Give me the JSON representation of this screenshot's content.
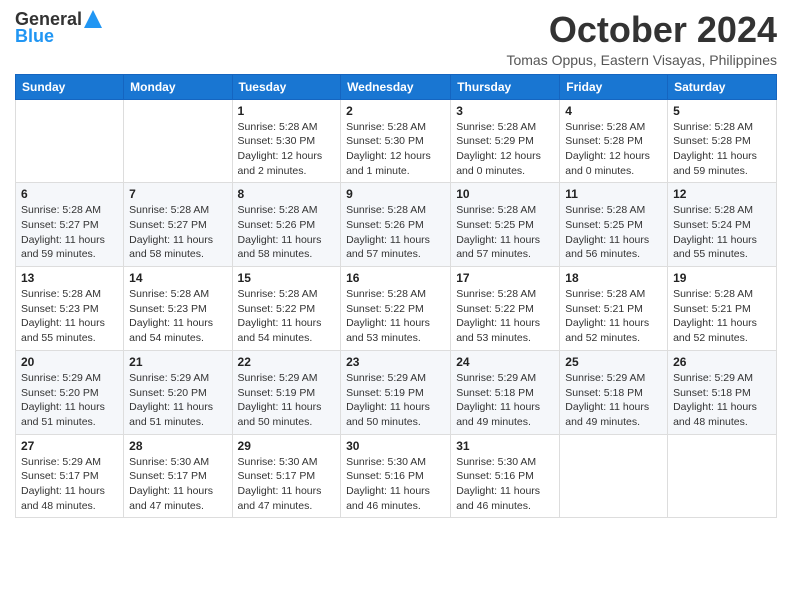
{
  "logo": {
    "general": "General",
    "blue": "Blue"
  },
  "header": {
    "month": "October 2024",
    "subtitle": "Tomas Oppus, Eastern Visayas, Philippines"
  },
  "days_of_week": [
    "Sunday",
    "Monday",
    "Tuesday",
    "Wednesday",
    "Thursday",
    "Friday",
    "Saturday"
  ],
  "weeks": [
    [
      {
        "day": "",
        "info": ""
      },
      {
        "day": "",
        "info": ""
      },
      {
        "day": "1",
        "info": "Sunrise: 5:28 AM\nSunset: 5:30 PM\nDaylight: 12 hours and 2 minutes."
      },
      {
        "day": "2",
        "info": "Sunrise: 5:28 AM\nSunset: 5:30 PM\nDaylight: 12 hours and 1 minute."
      },
      {
        "day": "3",
        "info": "Sunrise: 5:28 AM\nSunset: 5:29 PM\nDaylight: 12 hours and 0 minutes."
      },
      {
        "day": "4",
        "info": "Sunrise: 5:28 AM\nSunset: 5:28 PM\nDaylight: 12 hours and 0 minutes."
      },
      {
        "day": "5",
        "info": "Sunrise: 5:28 AM\nSunset: 5:28 PM\nDaylight: 11 hours and 59 minutes."
      }
    ],
    [
      {
        "day": "6",
        "info": "Sunrise: 5:28 AM\nSunset: 5:27 PM\nDaylight: 11 hours and 59 minutes."
      },
      {
        "day": "7",
        "info": "Sunrise: 5:28 AM\nSunset: 5:27 PM\nDaylight: 11 hours and 58 minutes."
      },
      {
        "day": "8",
        "info": "Sunrise: 5:28 AM\nSunset: 5:26 PM\nDaylight: 11 hours and 58 minutes."
      },
      {
        "day": "9",
        "info": "Sunrise: 5:28 AM\nSunset: 5:26 PM\nDaylight: 11 hours and 57 minutes."
      },
      {
        "day": "10",
        "info": "Sunrise: 5:28 AM\nSunset: 5:25 PM\nDaylight: 11 hours and 57 minutes."
      },
      {
        "day": "11",
        "info": "Sunrise: 5:28 AM\nSunset: 5:25 PM\nDaylight: 11 hours and 56 minutes."
      },
      {
        "day": "12",
        "info": "Sunrise: 5:28 AM\nSunset: 5:24 PM\nDaylight: 11 hours and 55 minutes."
      }
    ],
    [
      {
        "day": "13",
        "info": "Sunrise: 5:28 AM\nSunset: 5:23 PM\nDaylight: 11 hours and 55 minutes."
      },
      {
        "day": "14",
        "info": "Sunrise: 5:28 AM\nSunset: 5:23 PM\nDaylight: 11 hours and 54 minutes."
      },
      {
        "day": "15",
        "info": "Sunrise: 5:28 AM\nSunset: 5:22 PM\nDaylight: 11 hours and 54 minutes."
      },
      {
        "day": "16",
        "info": "Sunrise: 5:28 AM\nSunset: 5:22 PM\nDaylight: 11 hours and 53 minutes."
      },
      {
        "day": "17",
        "info": "Sunrise: 5:28 AM\nSunset: 5:22 PM\nDaylight: 11 hours and 53 minutes."
      },
      {
        "day": "18",
        "info": "Sunrise: 5:28 AM\nSunset: 5:21 PM\nDaylight: 11 hours and 52 minutes."
      },
      {
        "day": "19",
        "info": "Sunrise: 5:28 AM\nSunset: 5:21 PM\nDaylight: 11 hours and 52 minutes."
      }
    ],
    [
      {
        "day": "20",
        "info": "Sunrise: 5:29 AM\nSunset: 5:20 PM\nDaylight: 11 hours and 51 minutes."
      },
      {
        "day": "21",
        "info": "Sunrise: 5:29 AM\nSunset: 5:20 PM\nDaylight: 11 hours and 51 minutes."
      },
      {
        "day": "22",
        "info": "Sunrise: 5:29 AM\nSunset: 5:19 PM\nDaylight: 11 hours and 50 minutes."
      },
      {
        "day": "23",
        "info": "Sunrise: 5:29 AM\nSunset: 5:19 PM\nDaylight: 11 hours and 50 minutes."
      },
      {
        "day": "24",
        "info": "Sunrise: 5:29 AM\nSunset: 5:18 PM\nDaylight: 11 hours and 49 minutes."
      },
      {
        "day": "25",
        "info": "Sunrise: 5:29 AM\nSunset: 5:18 PM\nDaylight: 11 hours and 49 minutes."
      },
      {
        "day": "26",
        "info": "Sunrise: 5:29 AM\nSunset: 5:18 PM\nDaylight: 11 hours and 48 minutes."
      }
    ],
    [
      {
        "day": "27",
        "info": "Sunrise: 5:29 AM\nSunset: 5:17 PM\nDaylight: 11 hours and 48 minutes."
      },
      {
        "day": "28",
        "info": "Sunrise: 5:30 AM\nSunset: 5:17 PM\nDaylight: 11 hours and 47 minutes."
      },
      {
        "day": "29",
        "info": "Sunrise: 5:30 AM\nSunset: 5:17 PM\nDaylight: 11 hours and 47 minutes."
      },
      {
        "day": "30",
        "info": "Sunrise: 5:30 AM\nSunset: 5:16 PM\nDaylight: 11 hours and 46 minutes."
      },
      {
        "day": "31",
        "info": "Sunrise: 5:30 AM\nSunset: 5:16 PM\nDaylight: 11 hours and 46 minutes."
      },
      {
        "day": "",
        "info": ""
      },
      {
        "day": "",
        "info": ""
      }
    ]
  ]
}
